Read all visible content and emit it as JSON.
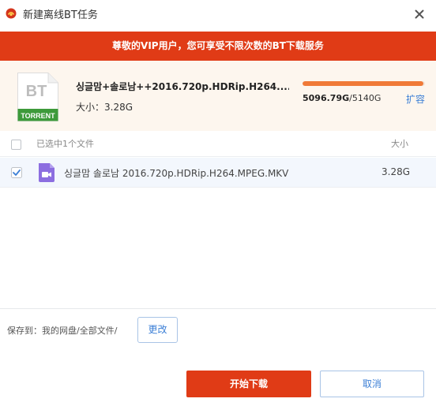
{
  "window": {
    "title": "新建离线BT任务",
    "logo_icon": "app-logo-icon",
    "close_icon": "close-icon"
  },
  "vip_banner": {
    "text": "尊敬的VIP用户，您可享受不限次数的BT下载服务"
  },
  "torrent": {
    "icon": "bt-torrent-file-icon",
    "icon_top_label": "BT",
    "icon_bottom_label": "TORRENT",
    "name": "싱글맘+솔로남++2016.720p.HDRip.H264....",
    "size_label": "大小：3.28G",
    "quota_used": "5096.79G",
    "quota_total": "/5140G",
    "quota_fraction": 0.99,
    "expand_label": "扩容"
  },
  "file_list": {
    "summary": "已选中1个文件",
    "size_header": "大小",
    "items": [
      {
        "checked": true,
        "icon": "video-file-icon",
        "name": "싱글맘 솔로남 2016.720p.HDRip.H264.MPEG.MKV",
        "size": "3.28G"
      }
    ]
  },
  "save": {
    "label": "保存到：我的网盘/全部文件/",
    "change_label": "更改"
  },
  "actions": {
    "start_label": "开始下载",
    "cancel_label": "取消"
  },
  "colors": {
    "accent_red": "#e03b16",
    "link_blue": "#3c7fd6",
    "quota_orange": "#f07a38",
    "panel_cream": "#fdf6ee",
    "bt_green": "#3d9a3a"
  }
}
